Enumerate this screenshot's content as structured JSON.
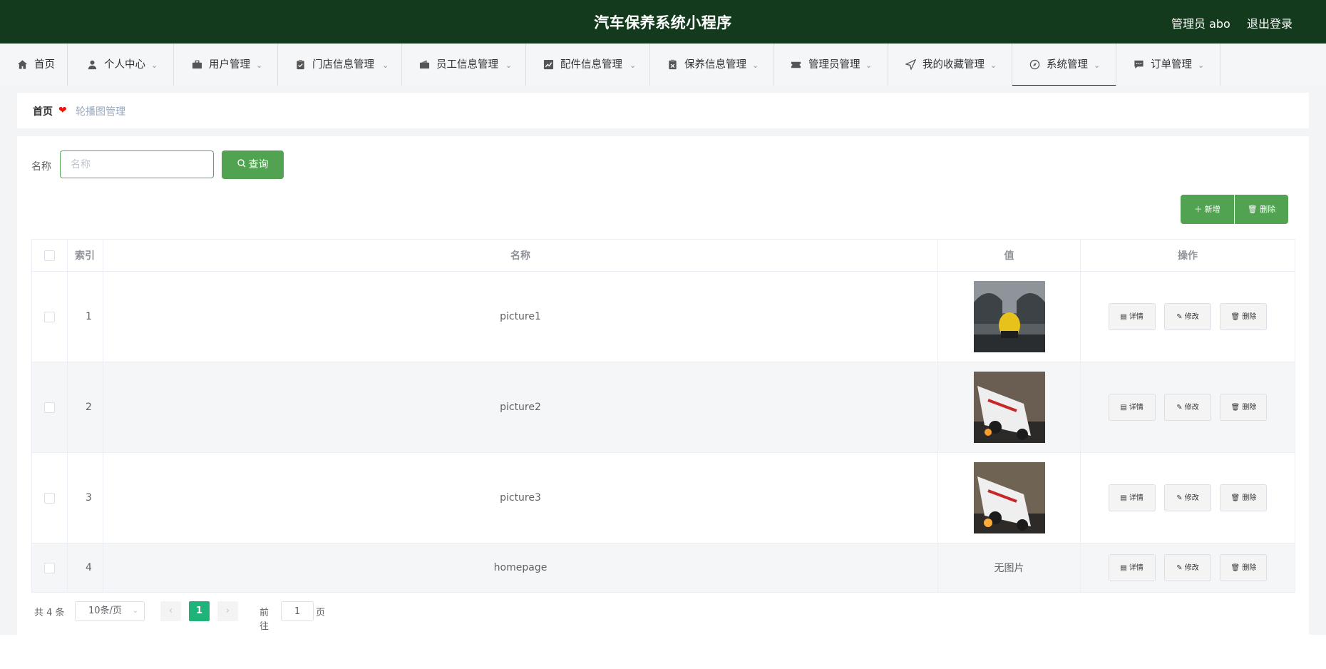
{
  "header": {
    "title": "汽车保养系统小程序",
    "user": "管理员 abo",
    "logout": "退出登录"
  },
  "nav": {
    "items": [
      {
        "label": "首页",
        "icon": "home-icon"
      },
      {
        "label": "个人中心",
        "icon": "user-icon"
      },
      {
        "label": "用户管理",
        "icon": "briefcase-icon"
      },
      {
        "label": "门店信息管理",
        "icon": "clipboard-icon"
      },
      {
        "label": "员工信息管理",
        "icon": "wallet-icon"
      },
      {
        "label": "配件信息管理",
        "icon": "chart-icon"
      },
      {
        "label": "保养信息管理",
        "icon": "checklist-icon"
      },
      {
        "label": "管理员管理",
        "icon": "ticket-icon"
      },
      {
        "label": "我的收藏管理",
        "icon": "send-icon"
      },
      {
        "label": "系统管理",
        "icon": "compass-icon"
      },
      {
        "label": "订单管理",
        "icon": "message-icon"
      }
    ],
    "active": "系统管理"
  },
  "breadcrumb": {
    "home": "首页",
    "current": "轮播图管理"
  },
  "search": {
    "label": "名称",
    "placeholder": "名称",
    "button": "查询"
  },
  "actions": {
    "add": "新增",
    "delete": "删除"
  },
  "table": {
    "columns": [
      "索引",
      "名称",
      "值",
      "操作"
    ],
    "rows": [
      {
        "index": "1",
        "name": "picture1",
        "value": "image"
      },
      {
        "index": "2",
        "name": "picture2",
        "value": "image"
      },
      {
        "index": "3",
        "name": "picture3",
        "value": "image"
      },
      {
        "index": "4",
        "name": "homepage",
        "value": "无图片"
      }
    ],
    "ops": {
      "detail": "详情",
      "edit": "修改",
      "delete": "删除"
    }
  },
  "pager": {
    "total": "共 4 条",
    "page_size": "10条/页",
    "current_page": "1",
    "goto_label": "前往",
    "goto_value": "1",
    "page_unit": "页"
  },
  "colors": {
    "header_bg": "#133a1d",
    "primary_green": "#51a351",
    "page_active": "#1fb37a",
    "heart": "#f0140a"
  }
}
